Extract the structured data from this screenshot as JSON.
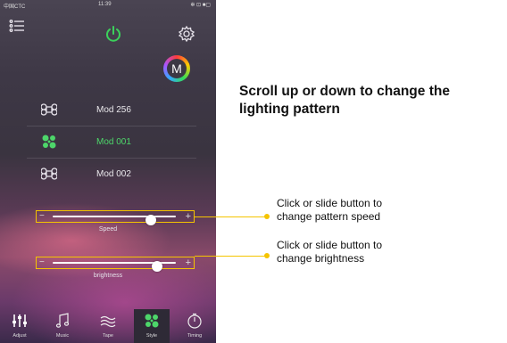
{
  "status": {
    "carrier": "中国CTC",
    "time": "11:39",
    "icons": "✻ ⊡ ■▢"
  },
  "header": {
    "menu_icon": "menu-icon",
    "power_icon": "power-icon",
    "settings_icon": "gear-icon",
    "accent": "#3bd15b"
  },
  "mode_badge": {
    "letter": "M"
  },
  "modes": [
    {
      "label": "Mod 256",
      "active": false
    },
    {
      "label": "Mod 001",
      "active": true
    },
    {
      "label": "Mod 002",
      "active": false
    }
  ],
  "sliders": {
    "speed": {
      "label": "Speed",
      "value": 0.8,
      "minus": "−",
      "plus": "+"
    },
    "brightness": {
      "label": "brightness",
      "value": 0.85,
      "minus": "−",
      "plus": "+"
    }
  },
  "tabs": [
    {
      "label": "Adjust",
      "icon": "sliders-icon"
    },
    {
      "label": "Music",
      "icon": "music-note-icon"
    },
    {
      "label": "Tape",
      "icon": "wave-icon"
    },
    {
      "label": "Style",
      "icon": "fan-icon",
      "active": true
    },
    {
      "label": "Timing",
      "icon": "stopwatch-icon"
    }
  ],
  "annotations": {
    "headline": "Scroll up or down to change the lighting pattern",
    "speed_note_line1": "Click or slide button to",
    "speed_note_line2": "change pattern speed",
    "brightness_note_line1": "Click or slide button to",
    "brightness_note_line2": "change brightness",
    "highlight_color": "#f5c400"
  }
}
